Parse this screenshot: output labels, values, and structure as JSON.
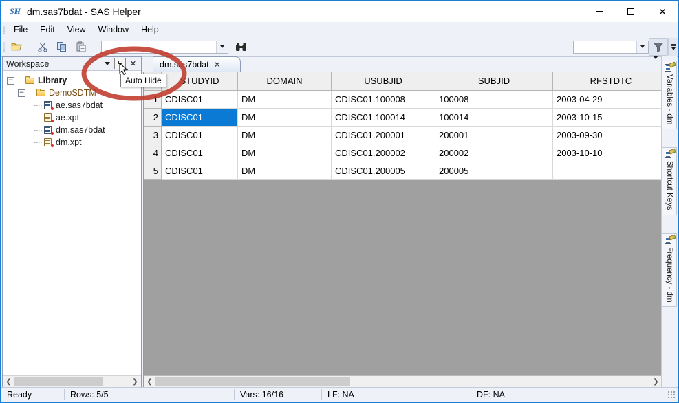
{
  "window": {
    "title": "dm.sas7bdat - SAS Helper",
    "app_badge": "SH",
    "minimize": "–",
    "maximize": "□",
    "close": "✕"
  },
  "menu": {
    "items": [
      {
        "label": "File"
      },
      {
        "label": "Edit"
      },
      {
        "label": "View"
      },
      {
        "label": "Window"
      },
      {
        "label": "Help"
      }
    ]
  },
  "toolbar": {
    "buttons": [
      {
        "name": "open-folder-icon",
        "glyph": "open"
      },
      {
        "name": "cut-icon",
        "glyph": "cut"
      },
      {
        "name": "copy-icon",
        "glyph": "copy"
      },
      {
        "name": "paste-icon",
        "glyph": "paste"
      }
    ],
    "search_combo_value": "",
    "search_combo_placeholder": "",
    "find_label": "find-binoculars-icon",
    "filter_combo_value": "",
    "filter_label": "filter-funnel-icon"
  },
  "workspace": {
    "title": "Workspace",
    "menu_glyph": "▼",
    "pin_label": "Auto Hide",
    "close_label": "✕",
    "tree": [
      {
        "label": "Library",
        "level": 0,
        "icon": "folder",
        "expander": "−",
        "bold": true
      },
      {
        "label": "DemoSDTM",
        "level": 1,
        "icon": "folder",
        "expander": "−",
        "bold": false
      },
      {
        "label": "ae.sas7bdat",
        "level": 2,
        "icon": "sas7bdat",
        "expander": "",
        "bold": false
      },
      {
        "label": "ae.xpt",
        "level": 2,
        "icon": "xpt",
        "expander": "",
        "bold": false
      },
      {
        "label": "dm.sas7bdat",
        "level": 2,
        "icon": "sas7bdat",
        "expander": "",
        "bold": false
      },
      {
        "label": "dm.xpt",
        "level": 2,
        "icon": "xpt",
        "expander": "",
        "bold": false
      }
    ]
  },
  "tooltip": {
    "text": "Auto Hide"
  },
  "document": {
    "tabs": [
      {
        "label": "dm.sas7bdat",
        "close": "✕",
        "active": true
      }
    ],
    "tab_list_glyph": "▼"
  },
  "grid": {
    "columns": [
      "STUDYID",
      "DOMAIN",
      "USUBJID",
      "SUBJID",
      "RFSTDTC"
    ],
    "rows": [
      {
        "num": "1",
        "cells": [
          "CDISC01",
          "DM",
          "CDISC01.100008",
          "100008",
          "2003-04-29"
        ]
      },
      {
        "num": "2",
        "cells": [
          "CDISC01",
          "DM",
          "CDISC01.100014",
          "100014",
          "2003-10-15"
        ]
      },
      {
        "num": "3",
        "cells": [
          "CDISC01",
          "DM",
          "CDISC01.200001",
          "200001",
          "2003-09-30"
        ]
      },
      {
        "num": "4",
        "cells": [
          "CDISC01",
          "DM",
          "CDISC01.200002",
          "200002",
          "2003-10-10"
        ]
      },
      {
        "num": "5",
        "cells": [
          "CDISC01",
          "DM",
          "CDISC01.200005",
          "200005",
          ""
        ]
      }
    ],
    "selected_row": 1,
    "selected_col": 0,
    "selection_color": "#0a7ad4",
    "empty_area_color": "#a0a0a0"
  },
  "rail": {
    "tabs": [
      {
        "label": "Variables - dm"
      },
      {
        "label": "Shortcut Keys"
      },
      {
        "label": "Frequency - dm"
      }
    ]
  },
  "status": {
    "ready": "Ready",
    "rows": "Rows: 5/5",
    "vars": "Vars: 16/16",
    "lf": "LF: NA",
    "df": "DF: NA"
  },
  "scroll": {
    "left_arrow": "❮",
    "right_arrow": "❯"
  },
  "annotation": {
    "color": "#c0392b",
    "shape": "ellipse-highlight"
  }
}
